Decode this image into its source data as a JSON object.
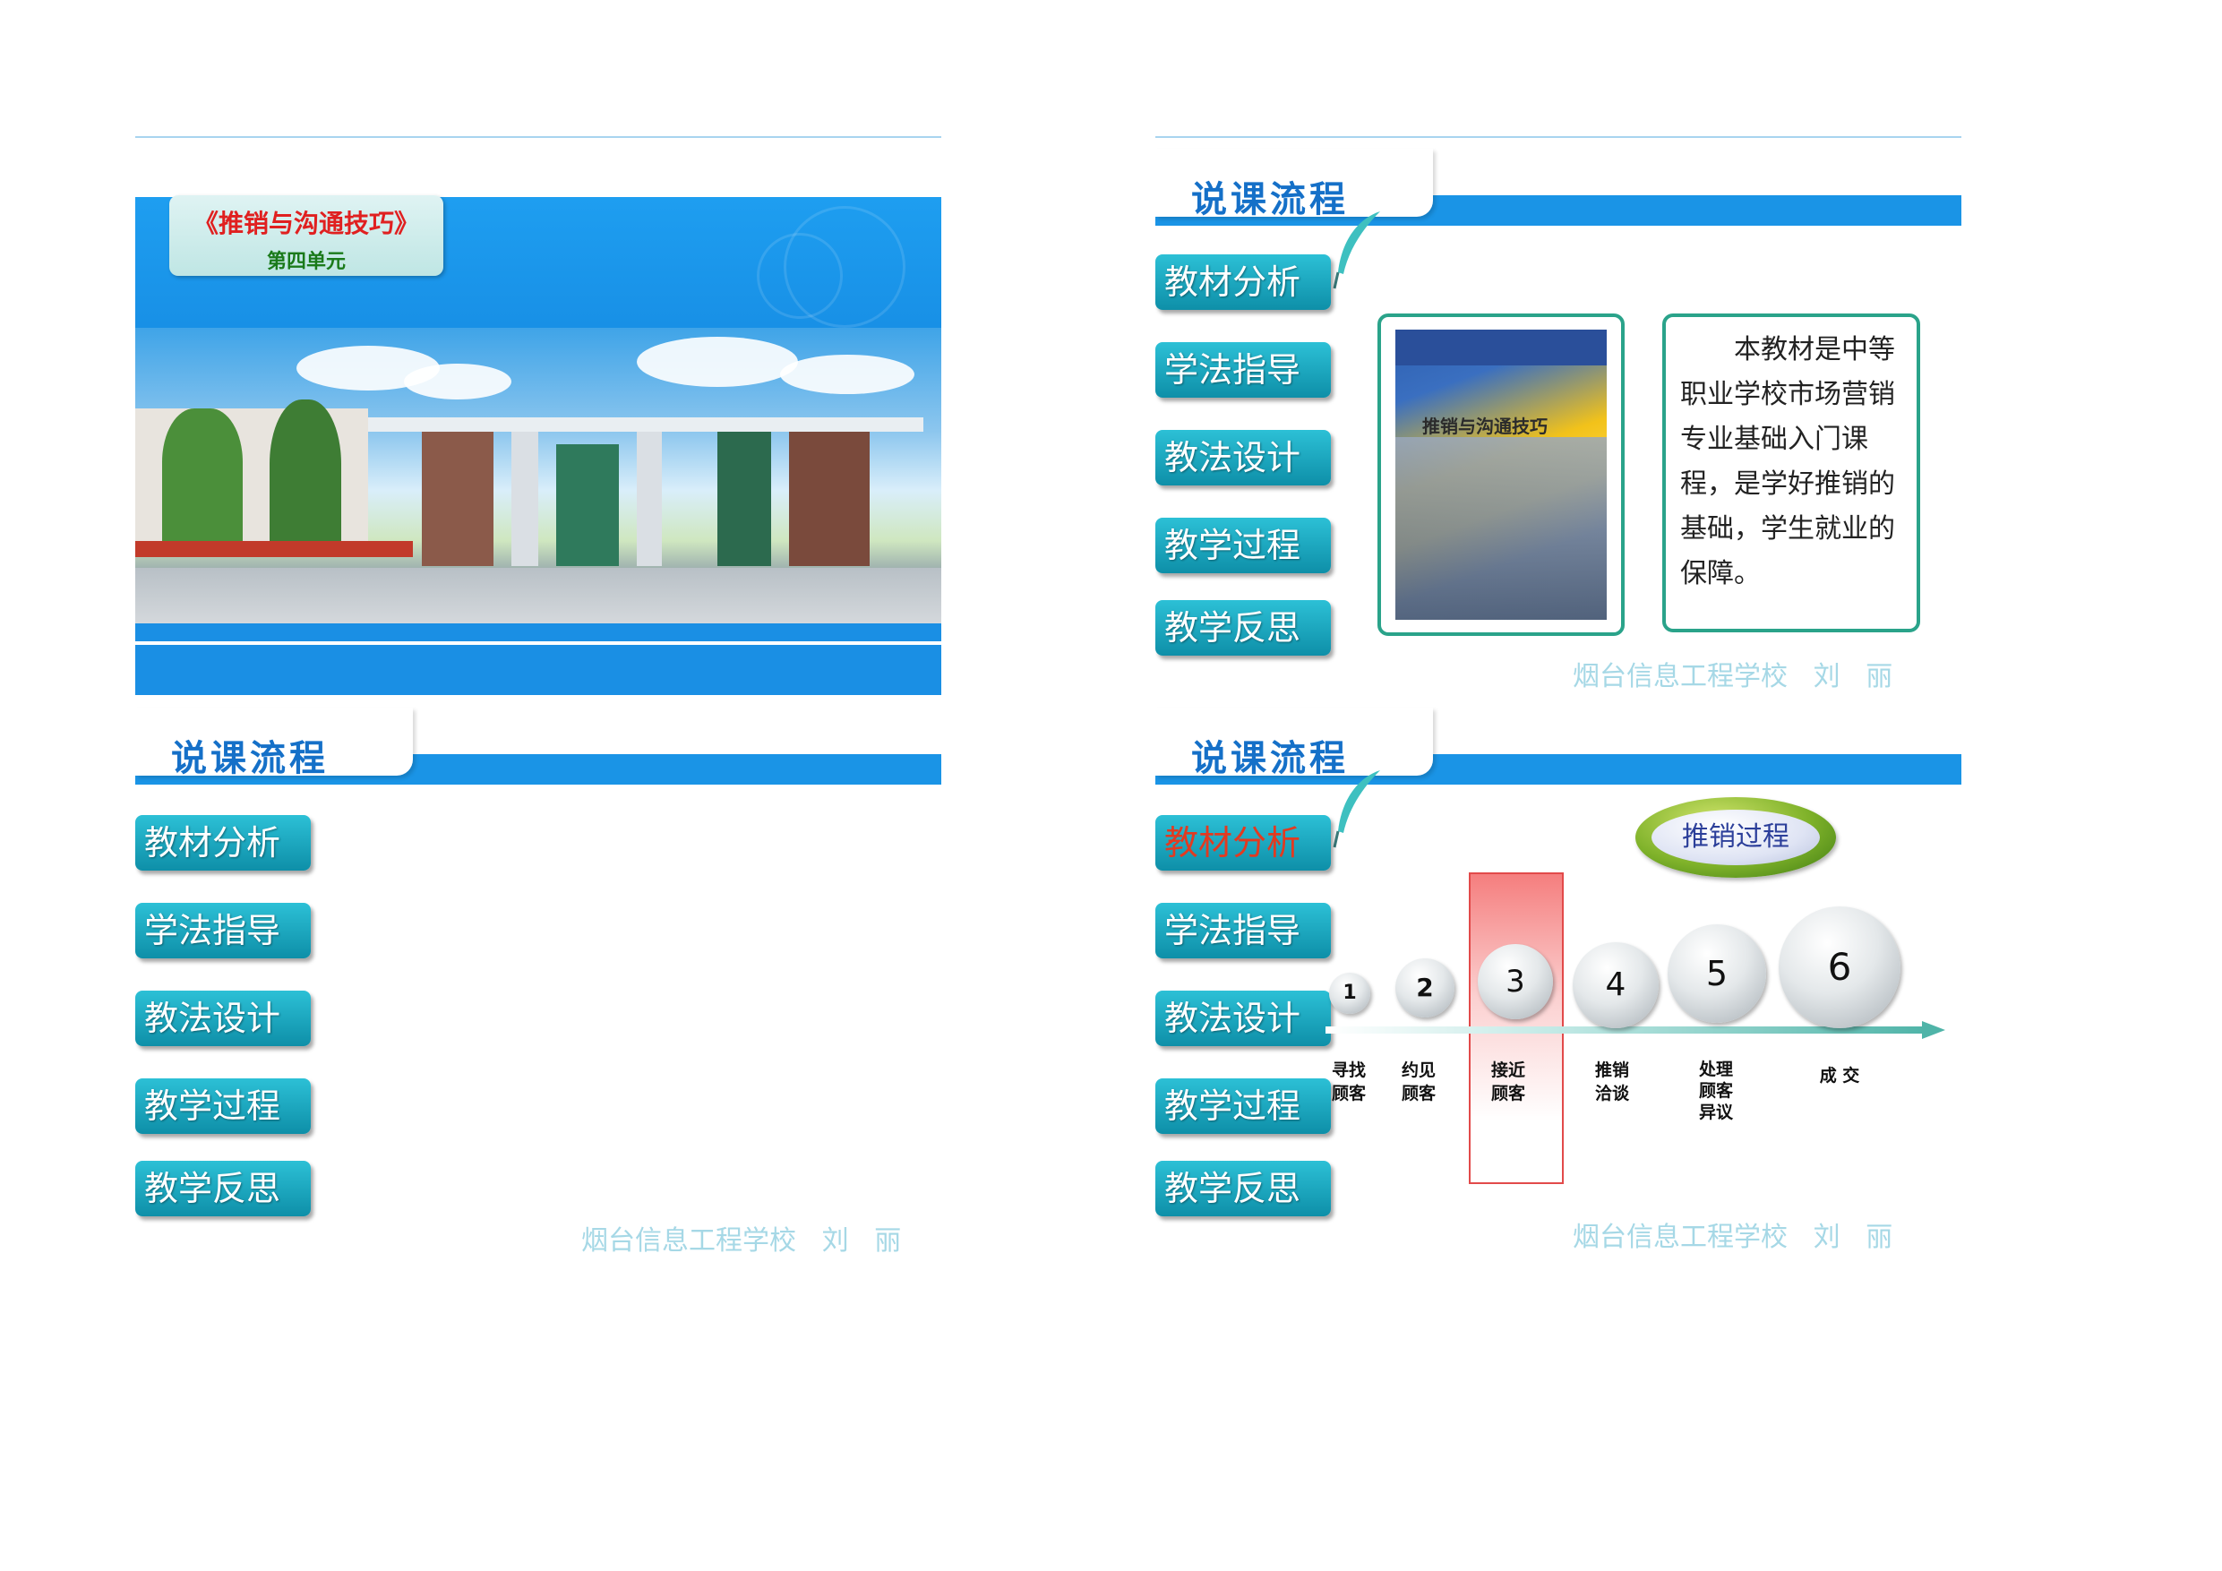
{
  "slide1": {
    "title": "《推销与沟通技巧》",
    "subtitle": "第四单元"
  },
  "slide2": {
    "header": "说课流程",
    "nav": [
      "教材分析",
      "学法指导",
      "教法设计",
      "教学过程",
      "教学反思"
    ],
    "book_title": "推销与沟通技巧",
    "description": "本教材是中等职业学校市场营销专业基础入门课程，是学好推销的基础，学生就业的保障。",
    "footer": "烟台信息工程学校   刘   丽"
  },
  "slide3": {
    "header": "说课流程",
    "nav": [
      "教材分析",
      "学法指导",
      "教法设计",
      "教学过程",
      "教学反思"
    ],
    "footer": "烟台信息工程学校   刘   丽"
  },
  "slide4": {
    "header": "说课流程",
    "nav": [
      "教材分析",
      "学法指导",
      "教法设计",
      "教学过程",
      "教学反思"
    ],
    "active_nav": "教材分析",
    "process_title": "推销过程",
    "steps": [
      {
        "num": "1",
        "label": "寻找\n顾客"
      },
      {
        "num": "2",
        "label": "约见\n顾客"
      },
      {
        "num": "3",
        "label": "接近\n顾客"
      },
      {
        "num": "4",
        "label": "推销\n洽谈"
      },
      {
        "num": "5",
        "label": "处理\n顾客\n异议"
      },
      {
        "num": "6",
        "label": "成 交"
      }
    ],
    "footer": "烟台信息工程学校   刘   丽"
  },
  "colors": {
    "header_blue": "#1a94e6",
    "nav_teal": "#0e8fa8",
    "frame_green": "#2aa38a",
    "highlight_red": "#e24a4a",
    "footer_text": "#a6d8e6"
  }
}
